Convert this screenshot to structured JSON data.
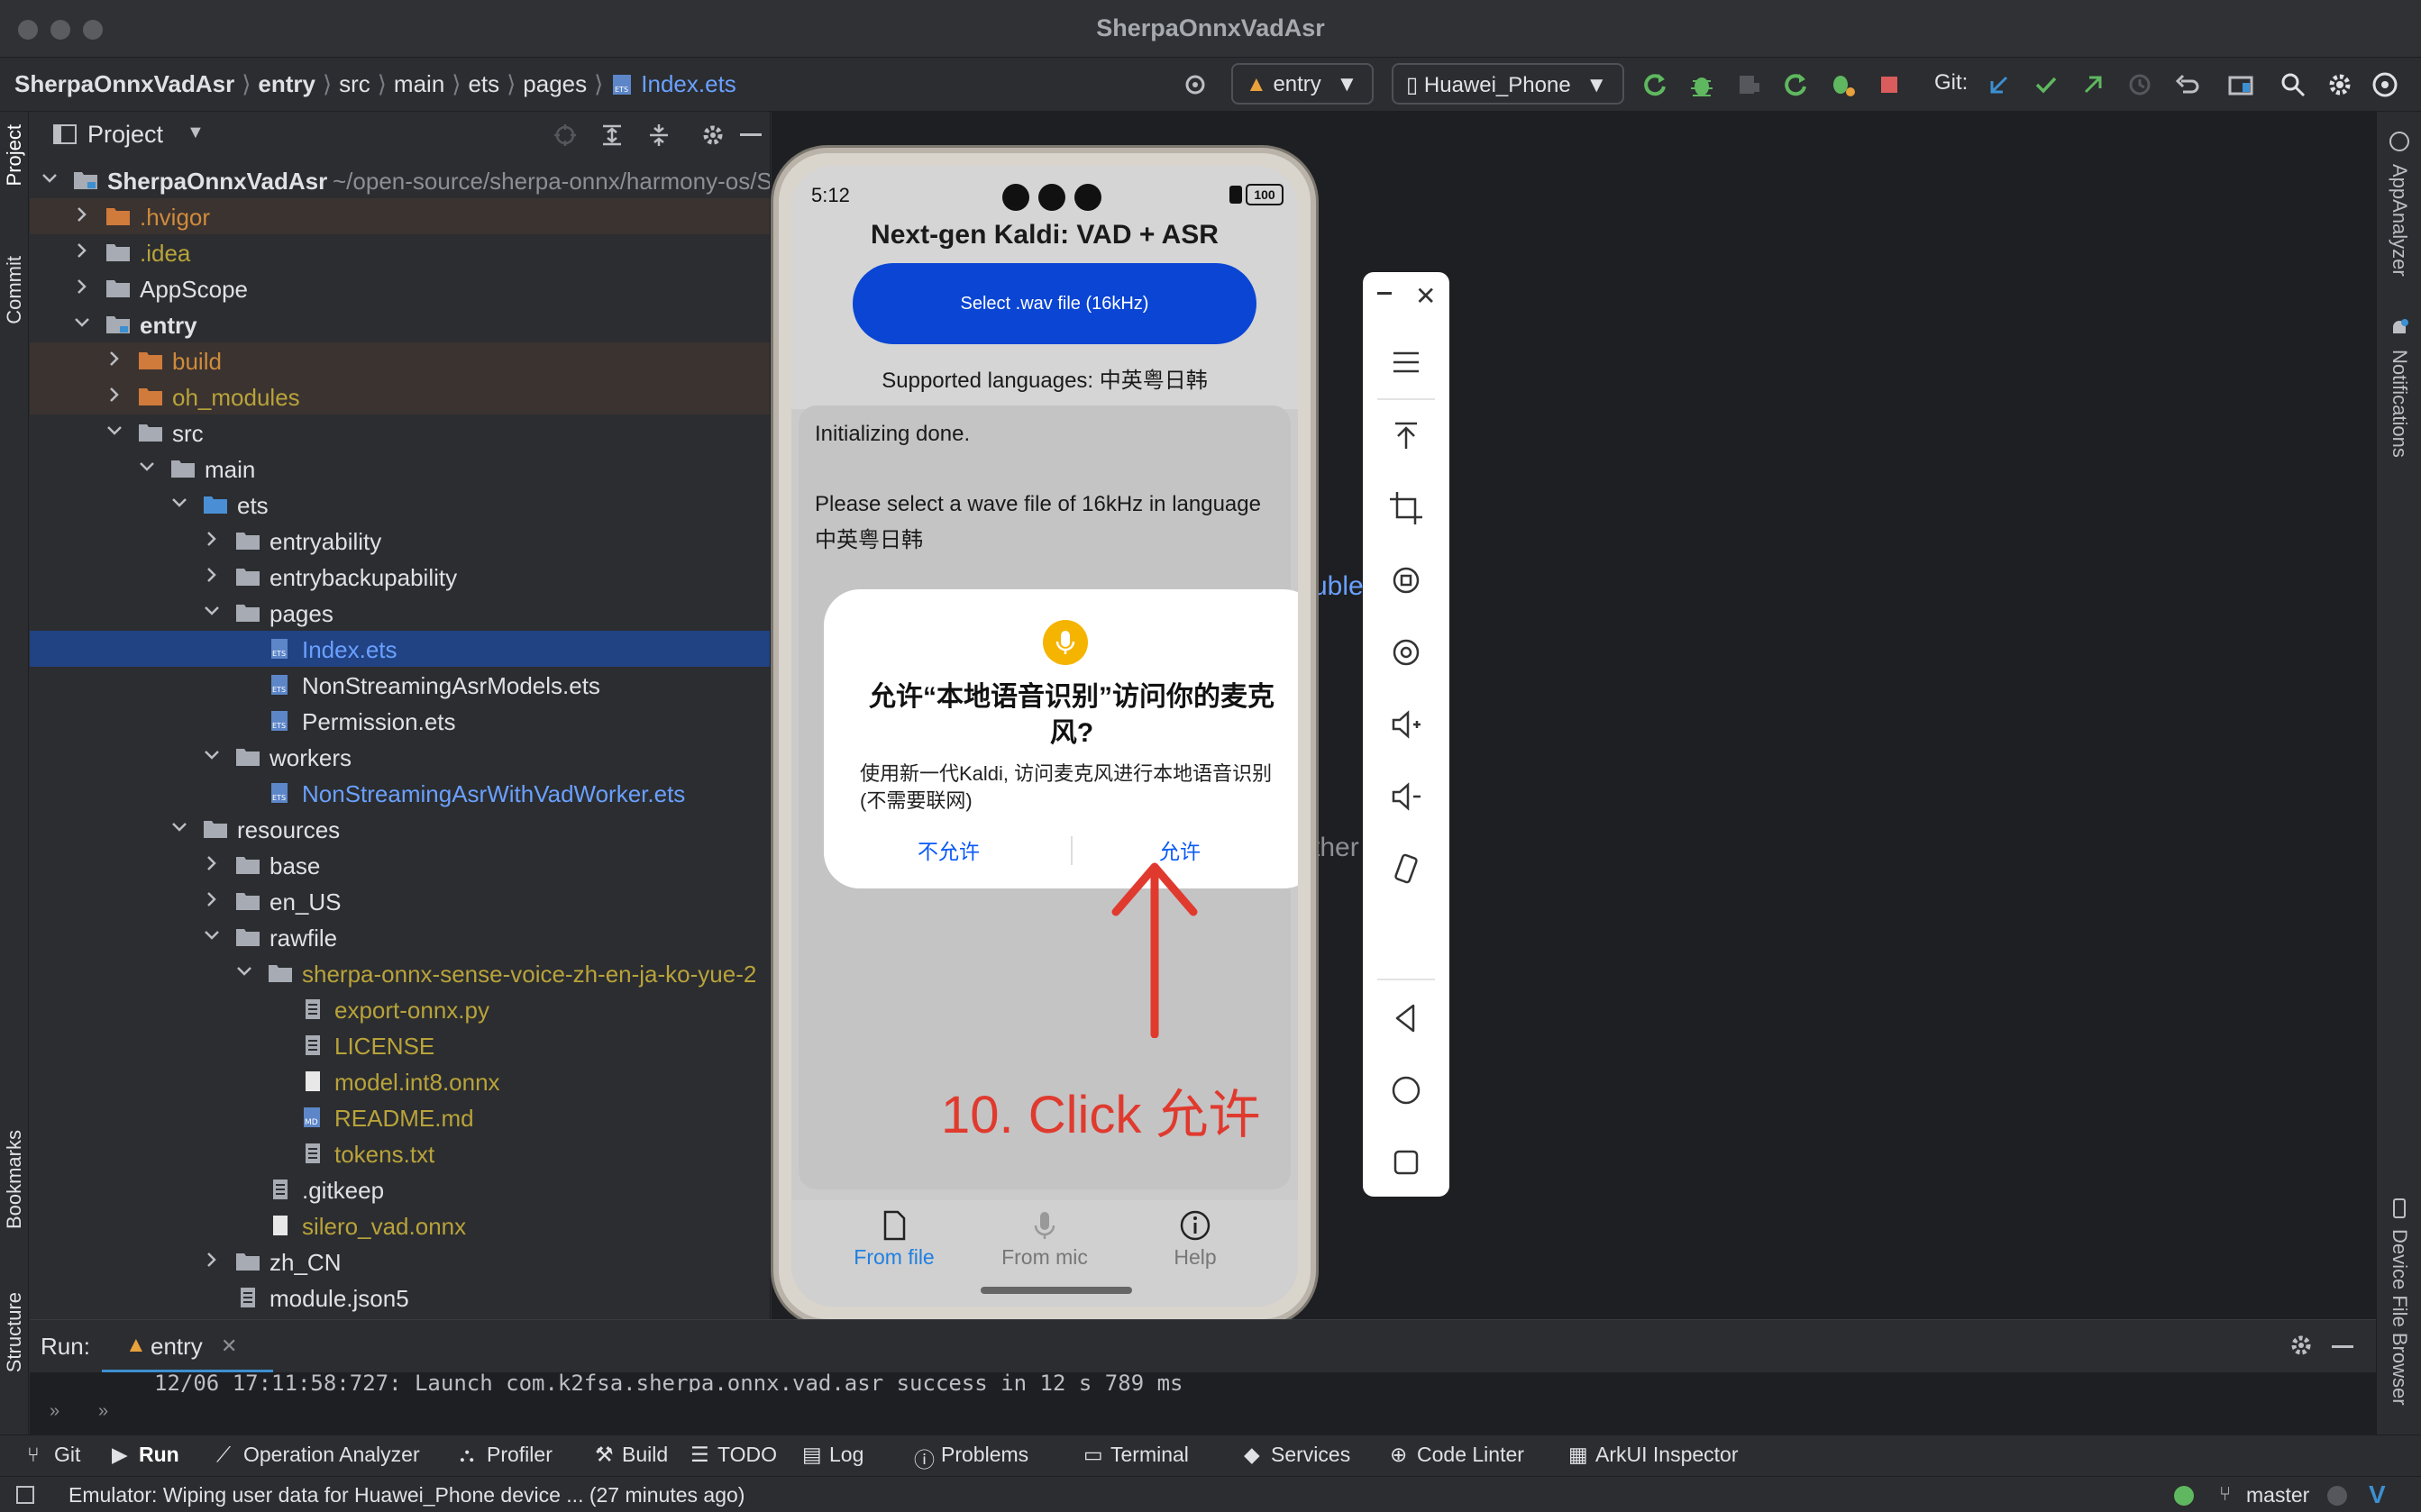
{
  "window": {
    "title": "SherpaOnnxVadAsr"
  },
  "breadcrumbs": [
    "SherpaOnnxVadAsr",
    "entry",
    "src",
    "main",
    "ets",
    "pages",
    "Index.ets"
  ],
  "toolbar": {
    "module": "entry",
    "device": "Huawei_Phone",
    "git_label": "Git:"
  },
  "left_stripe": {
    "project": "Project",
    "commit": "Commit",
    "bookmarks": "Bookmarks",
    "structure": "Structure"
  },
  "right_stripe": {
    "app_analyzer": "AppAnalyzer",
    "notifications": "Notifications",
    "device_file_browser": "Device File Browser"
  },
  "project_panel": {
    "title": "Project",
    "root_name": "SherpaOnnxVadAsr",
    "root_path": "~/open-source/sherpa-onnx/harmony-os/S",
    "tree": [
      {
        "label": ".hvigor",
        "depth": 1,
        "arrow": "right",
        "icon": "folder-orange",
        "color": "orange",
        "excluded": true
      },
      {
        "label": ".idea",
        "depth": 1,
        "arrow": "right",
        "icon": "folder",
        "color": "yellow",
        "excluded": false
      },
      {
        "label": "AppScope",
        "depth": 1,
        "arrow": "right",
        "icon": "folder",
        "color": "",
        "excluded": false
      },
      {
        "label": "entry",
        "depth": 1,
        "arrow": "down",
        "icon": "module",
        "color": "",
        "bold": true,
        "excluded": false
      },
      {
        "label": "build",
        "depth": 2,
        "arrow": "right",
        "icon": "folder-orange",
        "color": "orange",
        "excluded": true
      },
      {
        "label": "oh_modules",
        "depth": 2,
        "arrow": "right",
        "icon": "folder-orange",
        "color": "yellow",
        "excluded": true
      },
      {
        "label": "src",
        "depth": 2,
        "arrow": "down",
        "icon": "folder",
        "color": "",
        "excluded": false
      },
      {
        "label": "main",
        "depth": 3,
        "arrow": "down",
        "icon": "folder",
        "color": "",
        "excluded": false
      },
      {
        "label": "ets",
        "depth": 4,
        "arrow": "down",
        "icon": "folder-blue",
        "color": "",
        "excluded": false
      },
      {
        "label": "entryability",
        "depth": 5,
        "arrow": "right",
        "icon": "folder",
        "color": "",
        "excluded": false
      },
      {
        "label": "entrybackupability",
        "depth": 5,
        "arrow": "right",
        "icon": "folder",
        "color": "",
        "excluded": false
      },
      {
        "label": "pages",
        "depth": 5,
        "arrow": "down",
        "icon": "folder",
        "color": "",
        "excluded": false
      },
      {
        "label": "Index.ets",
        "depth": 6,
        "arrow": "",
        "icon": "ets",
        "color": "blue",
        "selected": true
      },
      {
        "label": "NonStreamingAsrModels.ets",
        "depth": 6,
        "arrow": "",
        "icon": "ets",
        "color": ""
      },
      {
        "label": "Permission.ets",
        "depth": 6,
        "arrow": "",
        "icon": "ets",
        "color": ""
      },
      {
        "label": "workers",
        "depth": 5,
        "arrow": "down",
        "icon": "folder",
        "color": ""
      },
      {
        "label": "NonStreamingAsrWithVadWorker.ets",
        "depth": 6,
        "arrow": "",
        "icon": "ets",
        "color": "blue"
      },
      {
        "label": "resources",
        "depth": 4,
        "arrow": "down",
        "icon": "folder",
        "color": ""
      },
      {
        "label": "base",
        "depth": 5,
        "arrow": "right",
        "icon": "folder",
        "color": ""
      },
      {
        "label": "en_US",
        "depth": 5,
        "arrow": "right",
        "icon": "folder",
        "color": ""
      },
      {
        "label": "rawfile",
        "depth": 5,
        "arrow": "down",
        "icon": "folder",
        "color": ""
      },
      {
        "label": "sherpa-onnx-sense-voice-zh-en-ja-ko-yue-2",
        "depth": 6,
        "arrow": "down",
        "icon": "folder",
        "color": "yellow"
      },
      {
        "label": "export-onnx.py",
        "depth": 7,
        "arrow": "",
        "icon": "file",
        "color": "yellow"
      },
      {
        "label": "LICENSE",
        "depth": 7,
        "arrow": "",
        "icon": "file",
        "color": "yellow"
      },
      {
        "label": "model.int8.onnx",
        "depth": 7,
        "arrow": "",
        "icon": "file-white",
        "color": "yellow"
      },
      {
        "label": "README.md",
        "depth": 7,
        "arrow": "",
        "icon": "md",
        "color": "yellow"
      },
      {
        "label": "tokens.txt",
        "depth": 7,
        "arrow": "",
        "icon": "file",
        "color": "yellow"
      },
      {
        "label": ".gitkeep",
        "depth": 6,
        "arrow": "",
        "icon": "file",
        "color": ""
      },
      {
        "label": "silero_vad.onnx",
        "depth": 6,
        "arrow": "",
        "icon": "file-white",
        "color": "yellow"
      },
      {
        "label": "zh_CN",
        "depth": 5,
        "arrow": "right",
        "icon": "folder",
        "color": ""
      },
      {
        "label": "module.json5",
        "depth": 5,
        "arrow": "",
        "icon": "file",
        "color": ""
      }
    ]
  },
  "editor_hints": [
    "uble",
    "ther"
  ],
  "phone": {
    "time": "5:12",
    "battery": "100",
    "app_title": "Next-gen Kaldi: VAD + ASR",
    "select_button": "Select .wav file (16kHz)",
    "supported": "Supported languages: 中英粤日韩",
    "result_line1": "Initializing done.",
    "result_line2": "Please select a wave file of 16kHz in language 中英粤日韩",
    "dialog": {
      "title": "允许“本地语音识别”访问你的麦克风?",
      "body": "使用新一代Kaldi, 访问麦克风进行本地语音识别 (不需要联网)",
      "deny": "不允许",
      "allow": "允许"
    },
    "tabs": [
      {
        "label": "From file",
        "active": true
      },
      {
        "label": "From mic",
        "active": false
      },
      {
        "label": "Help",
        "active": false
      }
    ]
  },
  "annotation": {
    "text": "10. Click 允许",
    "color": "#e03a2f"
  },
  "run_panel": {
    "label": "Run:",
    "tab": "entry",
    "log": "12/06 17:11:58:727: Launch com.k2fsa.sherpa.onnx.vad.asr success in 12 s 789 ms"
  },
  "tool_tabs": [
    "Git",
    "Run",
    "Operation Analyzer",
    "Profiler",
    "Build",
    "TODO",
    "Log",
    "Problems",
    "Terminal",
    "Services",
    "Code Linter",
    "ArkUI Inspector"
  ],
  "status": {
    "message": "Emulator: Wiping user data for Huawei_Phone device ... (27 minutes ago)",
    "branch": "master"
  },
  "colors": {
    "accent_blue": "#0a45d4",
    "dialog_link": "#0a59f7",
    "annotation_red": "#e03a2f",
    "selection": "#214283"
  }
}
